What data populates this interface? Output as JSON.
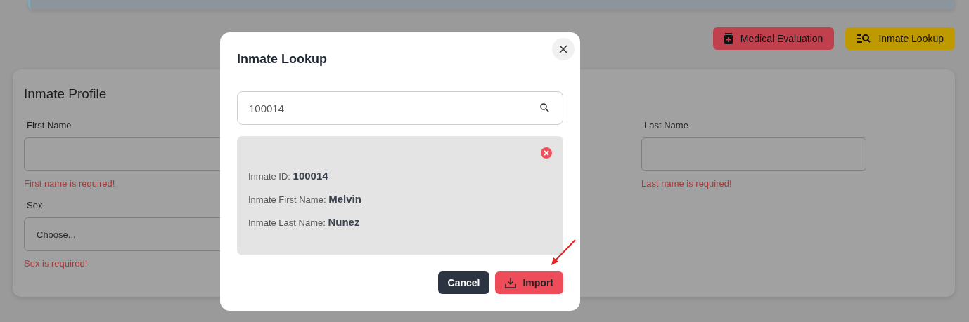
{
  "header_actions": [
    {
      "label": "Medical Evaluation",
      "kind": "medical"
    },
    {
      "label": "Inmate Lookup",
      "kind": "lookup"
    }
  ],
  "profile": {
    "title": "Inmate Profile",
    "rows": [
      [
        {
          "label": "First Name",
          "kind": "text",
          "error": "First name is required!"
        },
        {
          "label": "Last Name",
          "kind": "text",
          "error": "Last name is required!"
        }
      ],
      [
        {
          "label": "Sex",
          "kind": "select",
          "placeholder": "Choose...",
          "error": "Sex is required!"
        }
      ]
    ]
  },
  "modal": {
    "title": "Inmate Lookup",
    "search": {
      "value": "100014"
    },
    "result_lines": [
      "Inmate ID: **100014**",
      "Inmate First Name: **Melvin**",
      "Inmate Last Name: **Nunez**"
    ],
    "buttons": [
      {
        "label": "Cancel",
        "kind": "secondary"
      },
      {
        "label": "Import",
        "kind": "primary"
      }
    ]
  }
}
